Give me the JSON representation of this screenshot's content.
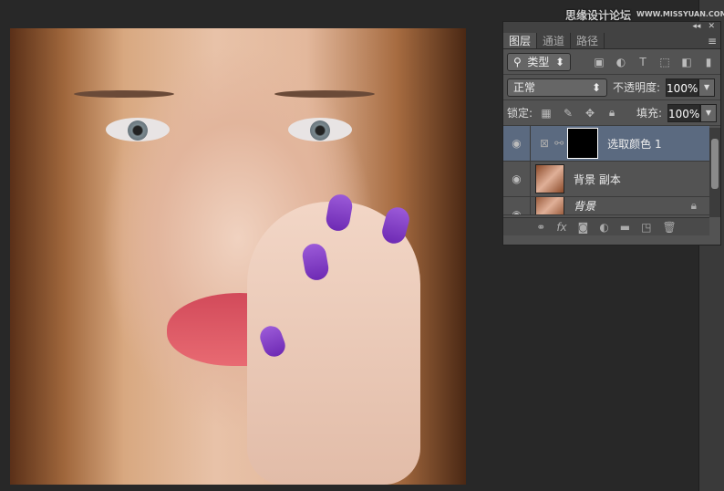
{
  "watermark": {
    "text": "思缘设计论坛",
    "url_text": "WWW.MISSYUAN.COM"
  },
  "panel": {
    "tabs": [
      {
        "label": "图层"
      },
      {
        "label": "通道"
      },
      {
        "label": "路径"
      }
    ],
    "filter": {
      "label": "类型",
      "icon": "search-icon"
    },
    "blend_mode": "正常",
    "opacity_label": "不透明度:",
    "opacity": "100%",
    "lock_label": "锁定:",
    "fill_label": "填充:",
    "fill": "100%",
    "layers": [
      {
        "name": "选取颜色 1",
        "selected": true
      },
      {
        "name": "背景 副本"
      },
      {
        "name": "背景",
        "locked": true
      }
    ],
    "bottom_icons": [
      "link-icon",
      "fx-icon",
      "mask-icon",
      "adjustment-icon",
      "folder-icon",
      "new-layer-icon",
      "trash-icon"
    ],
    "fx_label": "fx"
  }
}
